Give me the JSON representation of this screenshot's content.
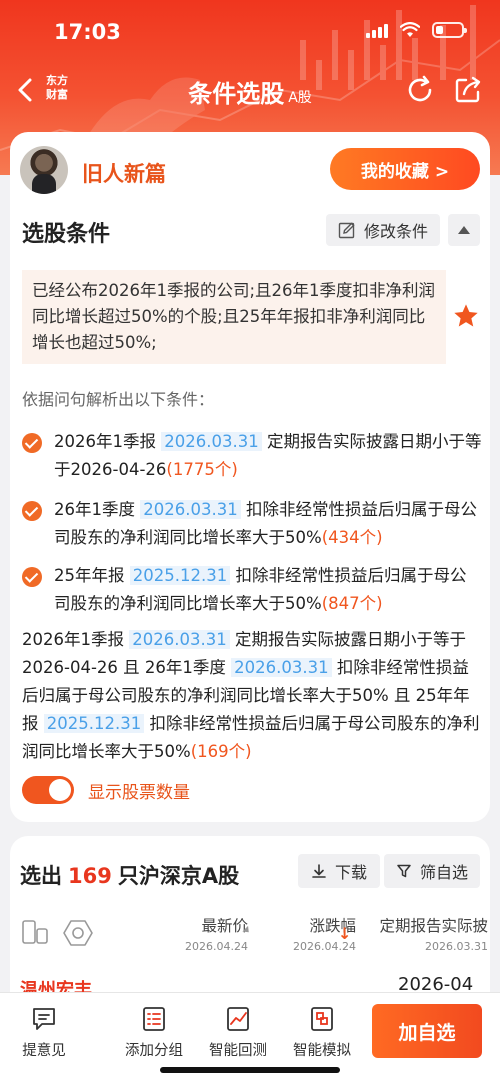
{
  "status_bar": {
    "time": "17:03",
    "battery_percent": 30
  },
  "nav": {
    "logo_line1": "东方",
    "logo_line2": "财富",
    "title": "条件选股",
    "title_sub": "A股"
  },
  "user": {
    "name": "旧人新篇",
    "favorites_label": "我的收藏 >"
  },
  "criteria": {
    "section_title": "选股条件",
    "modify_label": "修改条件",
    "query": "已经公布2026年1季报的公司;且26年1季度扣非净利润同比增长超过50%的个股;且25年年报扣非净利润同比增长也超过50%;",
    "parse_hint": "依据问句解析出以下条件：",
    "conditions": [
      {
        "prefix": "2026年1季报",
        "date": "2026.03.31",
        "text": "定期报告实际披露日期小于等于2026-04-26",
        "count": "(1775个)"
      },
      {
        "prefix": "26年1季度",
        "date": "2026.03.31",
        "text": "扣除非经常性损益后归属于母公司股东的净利润同比增长率大于50%",
        "count": "(434个)"
      },
      {
        "prefix": "25年年报",
        "date": "2025.12.31",
        "text": "扣除非经常性损益后归属于母公司股东的净利润同比增长率大于50%",
        "count": "(847个)"
      }
    ],
    "combined": {
      "p1": "2026年1季报",
      "d1": "2026.03.31",
      "t1": "定期报告实际披露日期小于等于2026-04-26 且 26年1季度",
      "d2": "2026.03.31",
      "t2": "扣除非经常性损益后归属于母公司股东的净利润同比增长率大于50% 且 25年年报",
      "d3": "2025.12.31",
      "t3": "扣除非经常性损益后归属于母公司股东的净利润同比增长率大于50%",
      "count": "(169个)"
    },
    "toggle_label": "显示股票数量",
    "toggle_on": true
  },
  "results": {
    "prefix": "选出",
    "count": "169",
    "suffix": "只沪深京A股",
    "download_label": "下载",
    "filter_label": "筛自选",
    "columns": [
      {
        "header": "最新价",
        "date": "2026.04.24"
      },
      {
        "header": "涨跌幅",
        "date": "2026.04.24"
      },
      {
        "header": "定期报告实际披",
        "date": "2026.03.31"
      }
    ],
    "first_row": {
      "name": "温州宏丰",
      "date_value": "2026-04"
    }
  },
  "bottom_bar": {
    "items": [
      {
        "label": "提意见",
        "icon": "feedback-icon"
      },
      {
        "label": "添加分组",
        "icon": "add-group-icon"
      },
      {
        "label": "智能回测",
        "icon": "backtest-icon"
      },
      {
        "label": "智能模拟",
        "icon": "simulate-icon"
      }
    ],
    "add_label": "加自选"
  },
  "colors": {
    "accent": "#f0561f",
    "brand_red": "#e8361e",
    "date_blue": "#4aa0e8"
  }
}
